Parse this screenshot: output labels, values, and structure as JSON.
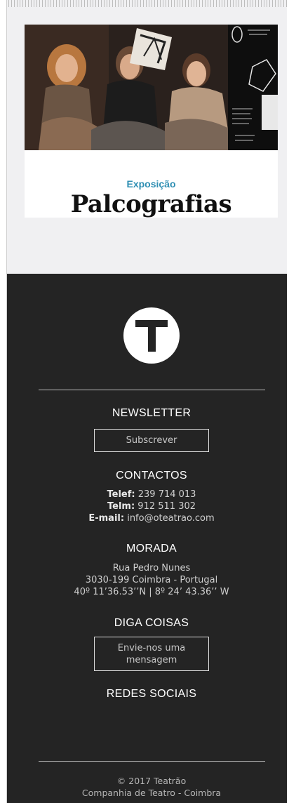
{
  "feature": {
    "kicker": "Exposição",
    "title": "Palcografias"
  },
  "footer": {
    "newsletter_heading": "NEWSLETTER",
    "subscribe_label": "Subscrever",
    "contacts_heading": "CONTACTOS",
    "phone_label": "Telef:",
    "phone_value": "239 714 013",
    "mobile_label": "Telm:",
    "mobile_value": "912 511 302",
    "email_label": "E-mail:",
    "email_value": "info@oteatrao.com",
    "address_heading": "MORADA",
    "address_street": "Rua Pedro Nunes",
    "address_city": "3030-199 Coimbra - Portugal",
    "address_coords": "40º 11’36.53’’N | 8º 24’ 43.36’’ W",
    "message_heading": "DIGA COISAS",
    "message_button_line1": "Envie-nos uma",
    "message_button_line2": "mensagem",
    "social_heading": "REDES SOCIAIS",
    "copyright": "© 2017 Teatrão",
    "company": "Companhia de Teatro - Coimbra"
  },
  "colors": {
    "accent": "#2f8fb3",
    "footer_bg": "#242424",
    "page_bg": "#f0f0f2"
  },
  "icons": {
    "logo": "teatrao-t-logo"
  }
}
